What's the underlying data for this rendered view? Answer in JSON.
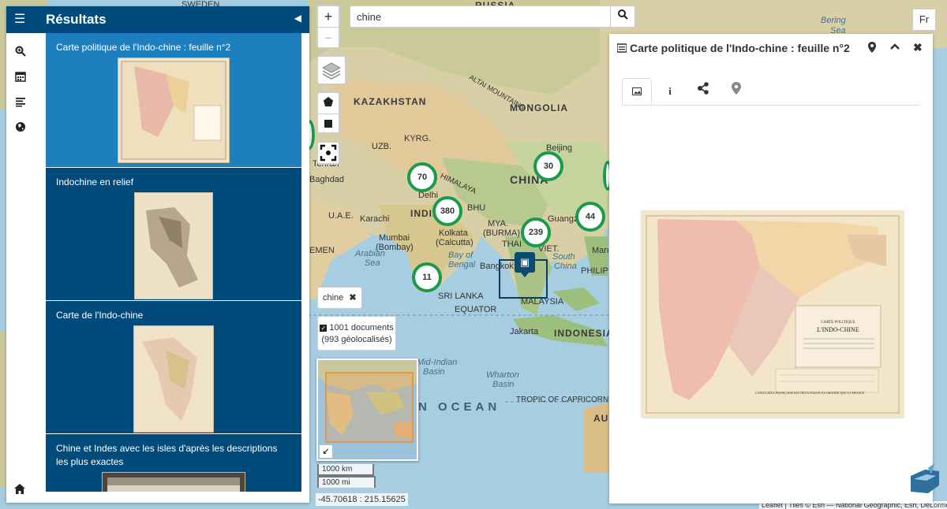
{
  "sidebar": {
    "title": "Résultats",
    "results": [
      {
        "title": "Carte politique de l'Indo-chine : feuille n°2",
        "active": true
      },
      {
        "title": "Indochine en relief"
      },
      {
        "title": "Carte de l'Indo-chine"
      },
      {
        "title": "Chine et Indes avec les isles d'après les descriptions les plus exactes"
      }
    ]
  },
  "search": {
    "value": "chine"
  },
  "language": "Fr",
  "filter": {
    "label": "chine"
  },
  "documents": {
    "count": "1001 documents",
    "geo": "(993 géolocalisés)"
  },
  "scale": {
    "km": "1000 km",
    "mi": "1000 mi"
  },
  "coords": "-45.70618 : 215.15625",
  "attribution": "Leaflet | Tiles © Esri — National Geographic, Esri, DeLorme",
  "clusters": [
    "70",
    "380",
    "30",
    "44",
    "239",
    "11"
  ],
  "map_labels": {
    "russia": "RUSSIA",
    "sweden": "SWEDEN",
    "kazakhstan": "KAZAKHSTAN",
    "mongolia": "MONGOLIA",
    "china": "CHINA",
    "india": "INDIA",
    "bering": "Bering",
    "sea": "Sea",
    "uzb": "UZB.",
    "kyrg": "KYRG.",
    "tehran": "Tehran",
    "baghdad": "Baghdad",
    "beijing": "Beijing",
    "delhi": "Delhi",
    "karachi": "Karachi",
    "mumbai": "Mumbai",
    "bombay": "(Bombay)",
    "kolkata": "Kolkata",
    "calcutta": "(Calcutta)",
    "guangzhou": "Guangzhou",
    "himalaya": "HIMALAYA",
    "altai": "ALTAI MOUNTAINS",
    "uae": "U.A.E.",
    "bhu": "BHU",
    "mya": "MYA.",
    "burma": "(BURMA)",
    "arabian": "Arabian",
    "arabian_sea": "Sea",
    "bay_of": "Bay of",
    "bengal": "Bengal",
    "bangkok": "Bangkok",
    "tha": "THAI",
    "viet": "VIET.",
    "south": "South",
    "china_sea": "China",
    "philip": "PHILIP",
    "manila": "Manila",
    "sri_lanka": "SRI LANKA",
    "malaysia": "MALAYSIA",
    "equator": "EQUATOR",
    "jakarta": "Jakarta",
    "indonesia": "INDONESIA",
    "mid_indian": "Mid-Indian",
    "basin": "Basin",
    "wharton": "Wharton",
    "wharton_basin": "Basin",
    "ocean": "N OCEAN",
    "capricorn": "TROPIC OF CAPRICORN",
    "au": "AU",
    "emen": "EMEN"
  },
  "detail": {
    "title": "Carte politique de l'Indo-chine : feuille n°2",
    "map_title_lines": [
      "CARTE POLITIQUE",
      "L'INDO-CHINE"
    ],
    "map_footer": "L'INDOCHINE FRANÇAISE EST DEUX FOIS PLUS GRANDE QUE LA FRANCE"
  },
  "icons": {
    "menu": "menu-icon",
    "search": "search-icon",
    "calendar": "calendar-icon",
    "list": "list-icon",
    "globe": "globe-icon",
    "home": "home-icon",
    "layers": "layers-icon",
    "polygon": "polygon-icon",
    "square": "square-icon",
    "fullscreen": "fullscreen-icon"
  },
  "colors": {
    "primary": "#004b7c",
    "active": "#1e7fbf",
    "cluster": "#1a9a4b"
  }
}
